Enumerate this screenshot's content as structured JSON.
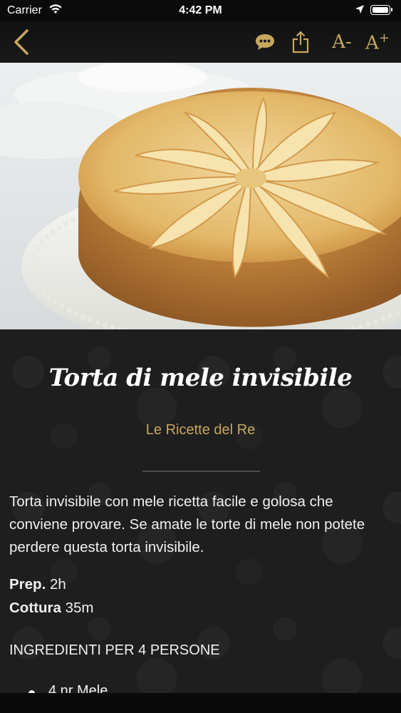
{
  "status_bar": {
    "carrier": "Carrier",
    "time": "4:42 PM"
  },
  "nav": {
    "icons": [
      "back-chevron-icon",
      "comments-icon",
      "share-icon",
      "font-decrease-icon",
      "font-increase-icon"
    ],
    "font_decrease_label": "A-",
    "font_increase_label": "A",
    "font_increase_sup": "+",
    "accent_color": "#c6a85d"
  },
  "hero": {
    "image": "apple-cake-photo"
  },
  "recipe": {
    "title": "Torta di mele invisibile",
    "source": "Le Ricette del Re",
    "description": "Torta invisibile con mele ricetta facile e golosa che conviene provare. Se amate le torte di mele non potete perdere questa torta invisibile.",
    "prep_label": "Prep.",
    "prep_value": "2h",
    "cook_label": "Cottura",
    "cook_value": "35m",
    "ingredients_heading": "INGREDIENTI PER 4 PERSONE",
    "ingredients": [
      "4 nr Mele"
    ]
  }
}
